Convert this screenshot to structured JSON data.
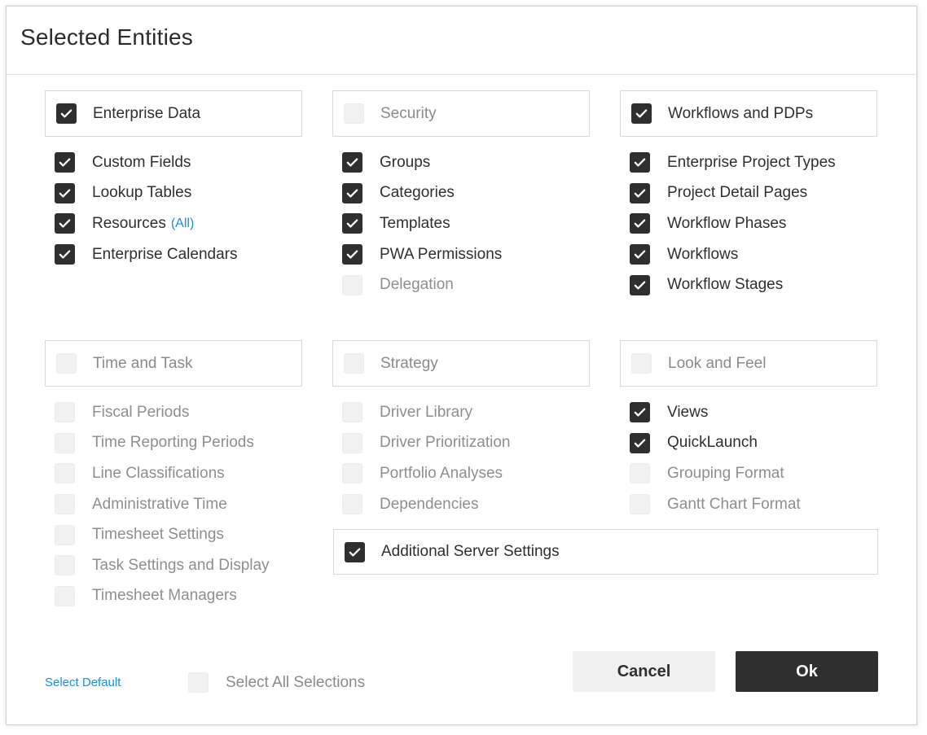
{
  "dialog": {
    "title": "Selected Entities"
  },
  "groups": [
    {
      "label": "Enterprise Data",
      "checked": true,
      "items": [
        {
          "label": "Custom Fields",
          "checked": true
        },
        {
          "label": "Lookup Tables",
          "checked": true
        },
        {
          "label": "Resources",
          "checked": true,
          "suffix": "(All)"
        },
        {
          "label": "Enterprise Calendars",
          "checked": true
        }
      ]
    },
    {
      "label": "Security",
      "checked": false,
      "items": [
        {
          "label": "Groups",
          "checked": true
        },
        {
          "label": "Categories",
          "checked": true
        },
        {
          "label": "Templates",
          "checked": true
        },
        {
          "label": "PWA Permissions",
          "checked": true
        },
        {
          "label": "Delegation",
          "checked": false
        }
      ]
    },
    {
      "label": "Workflows and PDPs",
      "checked": true,
      "items": [
        {
          "label": "Enterprise Project Types",
          "checked": true
        },
        {
          "label": "Project Detail Pages",
          "checked": true
        },
        {
          "label": "Workflow Phases",
          "checked": true
        },
        {
          "label": "Workflows",
          "checked": true
        },
        {
          "label": "Workflow Stages",
          "checked": true
        }
      ]
    },
    {
      "label": "Time and Task",
      "checked": false,
      "items": [
        {
          "label": "Fiscal Periods",
          "checked": false
        },
        {
          "label": "Time Reporting Periods",
          "checked": false
        },
        {
          "label": "Line Classifications",
          "checked": false
        },
        {
          "label": "Administrative Time",
          "checked": false
        },
        {
          "label": "Timesheet Settings",
          "checked": false
        },
        {
          "label": "Task Settings and Display",
          "checked": false
        },
        {
          "label": "Timesheet Managers",
          "checked": false
        }
      ]
    },
    {
      "label": "Strategy",
      "checked": false,
      "items": [
        {
          "label": "Driver Library",
          "checked": false
        },
        {
          "label": "Driver Prioritization",
          "checked": false
        },
        {
          "label": "Portfolio Analyses",
          "checked": false
        },
        {
          "label": "Dependencies",
          "checked": false
        }
      ]
    },
    {
      "label": "Look and Feel",
      "checked": false,
      "items": [
        {
          "label": "Views",
          "checked": true
        },
        {
          "label": "QuickLaunch",
          "checked": true
        },
        {
          "label": "Grouping Format",
          "checked": false
        },
        {
          "label": "Gantt Chart Format",
          "checked": false
        }
      ]
    }
  ],
  "additional": {
    "label": "Additional Server Settings",
    "checked": true
  },
  "footer": {
    "select_default": "Select Default",
    "select_all_label": "Select All Selections",
    "select_all_checked": false,
    "cancel_label": "Cancel",
    "ok_label": "Ok"
  },
  "colors": {
    "checked_fill": "#2f2f2f",
    "unchecked_fill": "#f1f1f1",
    "link": "#1a8fd6",
    "ok_button": "#2f2f2f",
    "cancel_button": "#f0f0f0"
  },
  "icons": {
    "checked": "checkmark-icon",
    "unchecked": "empty-checkbox-icon"
  }
}
